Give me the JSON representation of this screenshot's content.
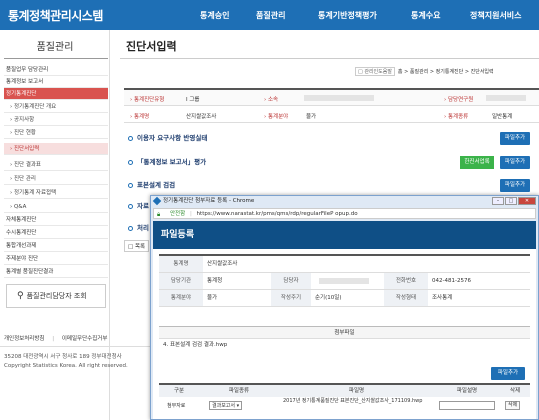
{
  "app": {
    "logo": "통계정책관리시스템"
  },
  "topnav": [
    "통계승인",
    "품질관리",
    "통계기반정책평가",
    "통계수요",
    "정책지원서비스"
  ],
  "sidebar": {
    "title": "품질관리",
    "items": [
      {
        "label": "품질업무 담당관리"
      },
      {
        "label": "통계정보 보고서"
      },
      {
        "label": "정기통계진단"
      },
      {
        "label": "› 정기통계진단 개요"
      },
      {
        "label": "› 공지사항"
      },
      {
        "label": "› 진단 현황"
      },
      {
        "label": "› 진단서입력"
      },
      {
        "label": "› 진단 결과표"
      },
      {
        "label": "› 진단 관리"
      },
      {
        "label": "› 정기통계 자료접택"
      },
      {
        "label": "› Q&A"
      },
      {
        "label": "자체통계진단"
      },
      {
        "label": "수시통계진단"
      },
      {
        "label": "통합개선과제"
      },
      {
        "label": "주제분야 진단"
      },
      {
        "label": "통계별 품질진단결과"
      }
    ],
    "search_label": "품질관리담당자 조회"
  },
  "footer": {
    "privacy": "개인정보처리방침",
    "email": "이메일무단수집거부",
    "address": "35208 대전광역시 서구 청사로 189 정부대전청사",
    "copyright": "Copyright Statistics Korea. All right reserved."
  },
  "main": {
    "title": "진단서입력",
    "breadcrumb_box": "□ 관리인도움말",
    "breadcrumb": "홈 > 품질관리 > 정기통계진단 > 진단서입력",
    "info": {
      "row1": [
        {
          "label": "› 통계진단유형",
          "value": "I 그룹"
        },
        {
          "label": "› 소속",
          "value": ""
        },
        {
          "label": "› 담당연구원",
          "value": ""
        }
      ],
      "row2": [
        {
          "label": "› 통계명",
          "value": "산지쌀값조사"
        },
        {
          "label": "› 통계분야",
          "value": "물가"
        },
        {
          "label": "› 통계종류",
          "value": "일반통계"
        }
      ]
    },
    "sections": [
      {
        "title": "이용자 요구사항 반영실태",
        "button": "파일추가"
      },
      {
        "title": "「통계정보 보고서」평가",
        "button": "파일추가",
        "button2": "한진서업록"
      },
      {
        "title": "표본설계 검검",
        "button": "파일추가"
      },
      {
        "title": "자료",
        "button": "파일추가"
      },
      {
        "title": "처리",
        "button": ""
      }
    ],
    "extra_row": "□ 목록"
  },
  "popup": {
    "title": "정기통계진단 첨부자료 등록 - Chrome",
    "secure": "안전함",
    "url": "https://www.narastat.kr/pms/qms/rdp/regularFileP opup.do",
    "header": "파일등록",
    "rows": [
      [
        {
          "label": "통계명",
          "value": "산지쌀값조사"
        }
      ],
      [
        {
          "label": "담당기관",
          "value": "통계청"
        },
        {
          "label": "담당자",
          "value": ""
        },
        {
          "label": "전화번호",
          "value": "042-481-2576"
        }
      ],
      [
        {
          "label": "통계분야",
          "value": "물가"
        },
        {
          "label": "작성주기",
          "value": "순기(10일)"
        },
        {
          "label": "작성형태",
          "value": "조사통계"
        }
      ]
    ],
    "attach_header": "첨부파일",
    "attach_file": "4. 표본설계 검검 결과.hwp",
    "add_button": "파일추가",
    "file_headers": [
      "구분",
      "파일종류",
      "파일명",
      "파일설명",
      "삭제"
    ],
    "file_row": {
      "kind": "첨부자료",
      "type": "결과보고서 ▾",
      "name": "2017년 정기통계품질진단 표본진단_산지쌀값조사_171109.hwp",
      "desc": "",
      "delete": "삭제"
    }
  },
  "colors": {
    "topbar": "#1e6fb5",
    "active": "#d9534f",
    "popup_header": "#0f4f86",
    "green": "#3bb34a"
  }
}
